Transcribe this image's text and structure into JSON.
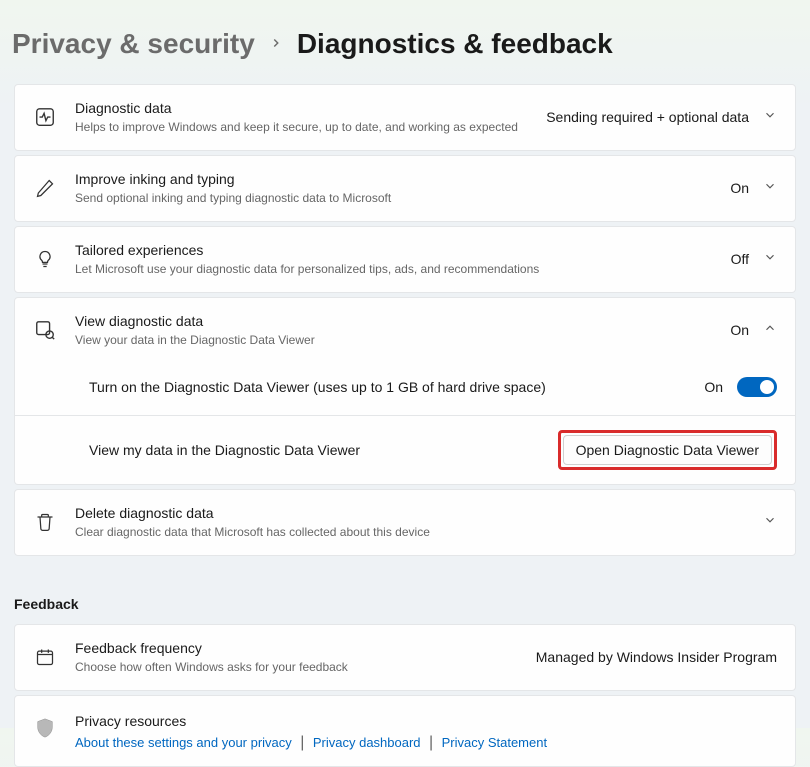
{
  "breadcrumb": {
    "parent": "Privacy & security",
    "current": "Diagnostics & feedback"
  },
  "cards": {
    "diagnostic_data": {
      "title": "Diagnostic data",
      "desc": "Helps to improve Windows and keep it secure, up to date, and working as expected",
      "value": "Sending required + optional data"
    },
    "inking": {
      "title": "Improve inking and typing",
      "desc": "Send optional inking and typing diagnostic data to Microsoft",
      "value": "On"
    },
    "tailored": {
      "title": "Tailored experiences",
      "desc": "Let Microsoft use your diagnostic data for personalized tips, ads, and recommendations",
      "value": "Off"
    },
    "view_diag": {
      "title": "View diagnostic data",
      "desc": "View your data in the Diagnostic Data Viewer",
      "value": "On"
    },
    "turn_on_viewer": {
      "title": "Turn on the Diagnostic Data Viewer (uses up to 1 GB of hard drive space)",
      "value": "On"
    },
    "view_my_data": {
      "title": "View my data in the Diagnostic Data Viewer",
      "button": "Open Diagnostic Data Viewer"
    },
    "delete_diag": {
      "title": "Delete diagnostic data",
      "desc": "Clear diagnostic data that Microsoft has collected about this device"
    }
  },
  "feedback_header": "Feedback",
  "feedback": {
    "frequency": {
      "title": "Feedback frequency",
      "desc": "Choose how often Windows asks for your feedback",
      "value": "Managed by Windows Insider Program"
    },
    "privacy_resources": {
      "title": "Privacy resources",
      "links": {
        "about": "About these settings and your privacy",
        "dashboard": "Privacy dashboard",
        "statement": "Privacy Statement"
      }
    }
  }
}
